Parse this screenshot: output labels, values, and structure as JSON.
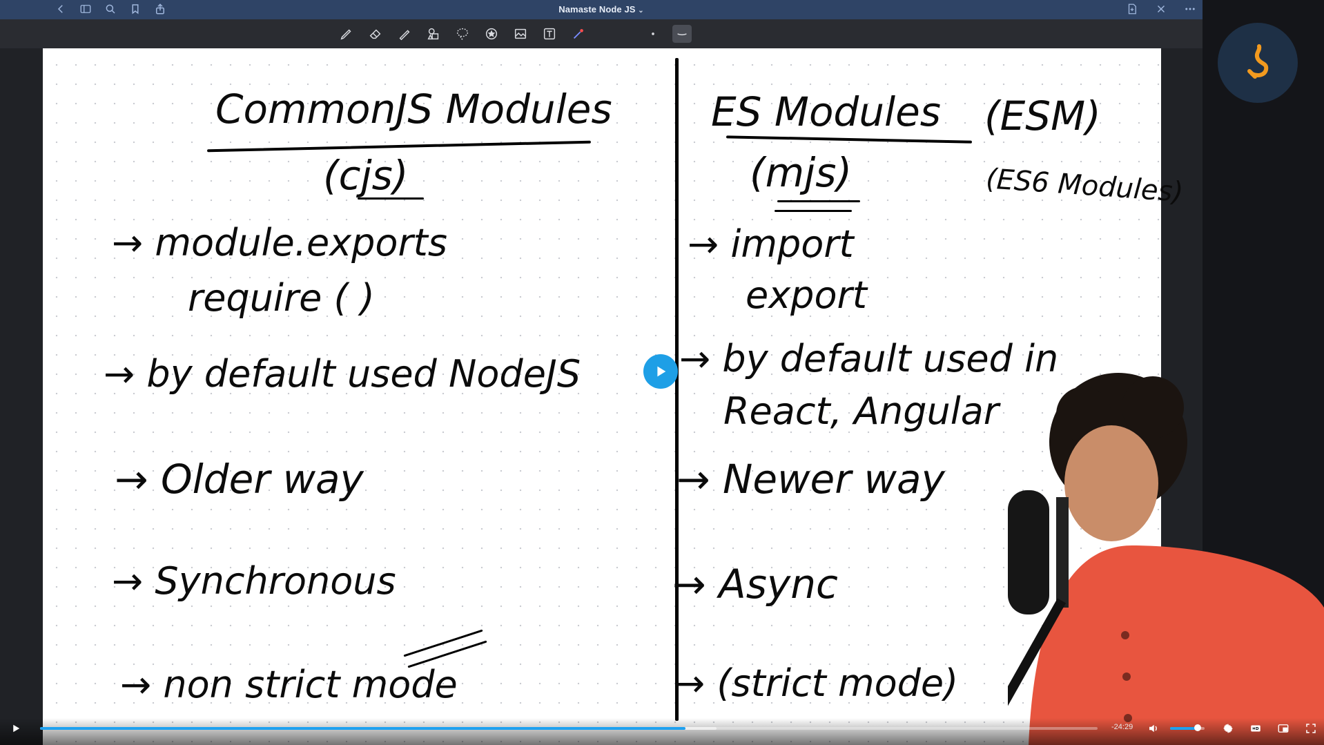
{
  "app": {
    "title": "Namaste Node JS",
    "title_chevron": "⌄"
  },
  "icons": {
    "titlebar_left": [
      "back-icon",
      "sidebar-icon",
      "search-icon",
      "bookmark-icon",
      "share-icon"
    ],
    "titlebar_right": [
      "add-page-icon",
      "close-icon",
      "more-icon"
    ],
    "tools": [
      "pen-icon",
      "eraser-icon",
      "highlighter-icon",
      "shapes-icon",
      "lasso-icon",
      "sticker-icon",
      "image-icon",
      "text-icon",
      "laser-icon",
      "dot-icon",
      "stroke-icon"
    ]
  },
  "notes": {
    "left": {
      "heading": "CommonJS Modules",
      "sub": "(cjs)",
      "p1a": "→ module.exports",
      "p1b": "require ( )",
      "p2": "→ by default used NodeJS",
      "p3": "→ Older way",
      "p4": "→ Synchronous",
      "p5": "→ non strict mode"
    },
    "right": {
      "heading": "ES Modules",
      "heading_paren": "(ESM)",
      "sub": "(mjs)",
      "alt": "(ES6 Modules)",
      "p1a": "→ import",
      "p1b": "export",
      "p2a": "→ by default used in",
      "p2b": "React, Angular",
      "p3": "→ Newer way",
      "p4": "→ Async",
      "p5": "→ (strict mode)"
    }
  },
  "player": {
    "time_remaining": "-24:29",
    "progress": 0.61,
    "buffered": 0.64,
    "volume": 0.8
  },
  "colors": {
    "titlebar": "#2f4466",
    "accent": "#1ea1f0",
    "logo_bg": "#1e3046",
    "logo_mark": "#f29a1f",
    "shirt": "#e8553f"
  }
}
